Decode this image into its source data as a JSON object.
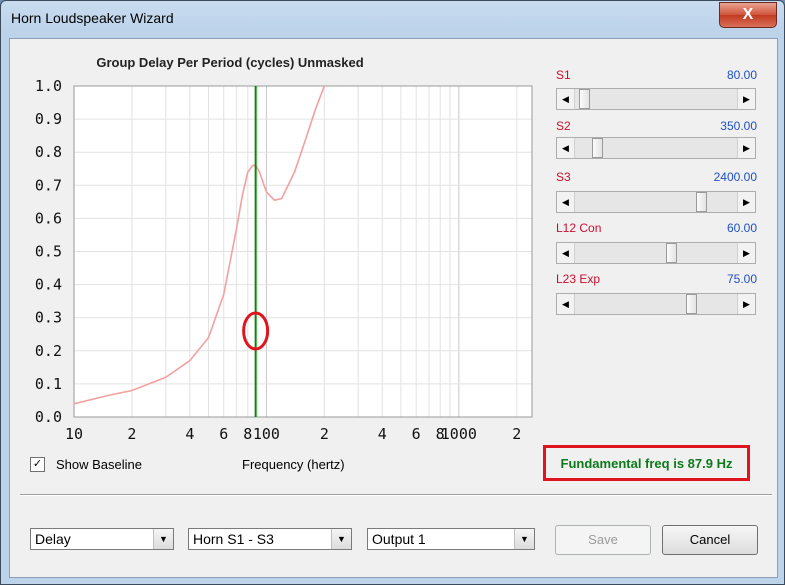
{
  "window": {
    "title": "Horn Loudspeaker Wizard",
    "close_glyph": "X"
  },
  "chart_data": {
    "type": "line",
    "title": "Group Delay Per Period (cycles)   Unmasked",
    "xlabel": "Frequency (hertz)",
    "xscale": "log",
    "xlim": [
      10,
      200
    ],
    "ylim": [
      0,
      1
    ],
    "grid": true,
    "y_tick_labels": [
      "1.0",
      "0.9",
      "0.8",
      "0.7",
      "0.6",
      "0.5",
      "0.4",
      "0.3",
      "0.2",
      "0.1",
      "0.0"
    ],
    "x_tick_labels": [
      {
        "x": 10,
        "label": "10"
      },
      {
        "x": 20,
        "label": "2"
      },
      {
        "x": 40,
        "label": "4"
      },
      {
        "x": 60,
        "label": "6"
      },
      {
        "x": 80,
        "label": "8"
      },
      {
        "x": 100,
        "label": "100"
      },
      {
        "x": 200,
        "label": "2"
      },
      {
        "x": 400,
        "label": "4"
      },
      {
        "x": 600,
        "label": "6"
      },
      {
        "x": 800,
        "label": "8"
      },
      {
        "x": 1000,
        "label": "1000"
      },
      {
        "x": 2000,
        "label": "2"
      }
    ],
    "series": [
      {
        "color": "#f4a0a0",
        "x": [
          10,
          15,
          20,
          30,
          40,
          50,
          60,
          70,
          75,
          80,
          85,
          88,
          92,
          100,
          110,
          120,
          140,
          160,
          180,
          200
        ],
        "y": [
          0.04,
          0.065,
          0.08,
          0.12,
          0.17,
          0.24,
          0.37,
          0.57,
          0.67,
          0.74,
          0.76,
          0.76,
          0.74,
          0.68,
          0.655,
          0.66,
          0.74,
          0.84,
          0.93,
          1.0
        ]
      }
    ],
    "marker_line": {
      "x": 87.9,
      "color": "#108010"
    },
    "highlight_circle": {
      "x": 87.9,
      "y": 0.26,
      "color": "#e0141e"
    }
  },
  "parameters": [
    {
      "name": "S1",
      "value": "80.00",
      "fraction": 0.03
    },
    {
      "name": "S2",
      "value": "350.00",
      "fraction": 0.12
    },
    {
      "name": "S3",
      "value": "2400.00",
      "fraction": 0.8
    },
    {
      "name": "L12  Con",
      "value": "60.00",
      "fraction": 0.6
    },
    {
      "name": "L23  Exp",
      "value": "75.00",
      "fraction": 0.73
    }
  ],
  "show_baseline": {
    "label": "Show Baseline",
    "checked": true,
    "check_glyph": "✓"
  },
  "fundamental": "Fundamental freq is 87.9 Hz",
  "dropdowns": [
    {
      "value": "Delay"
    },
    {
      "value": "Horn S1 - S3"
    },
    {
      "value": "Output 1"
    }
  ],
  "buttons": {
    "save": "Save",
    "cancel": "Cancel"
  }
}
